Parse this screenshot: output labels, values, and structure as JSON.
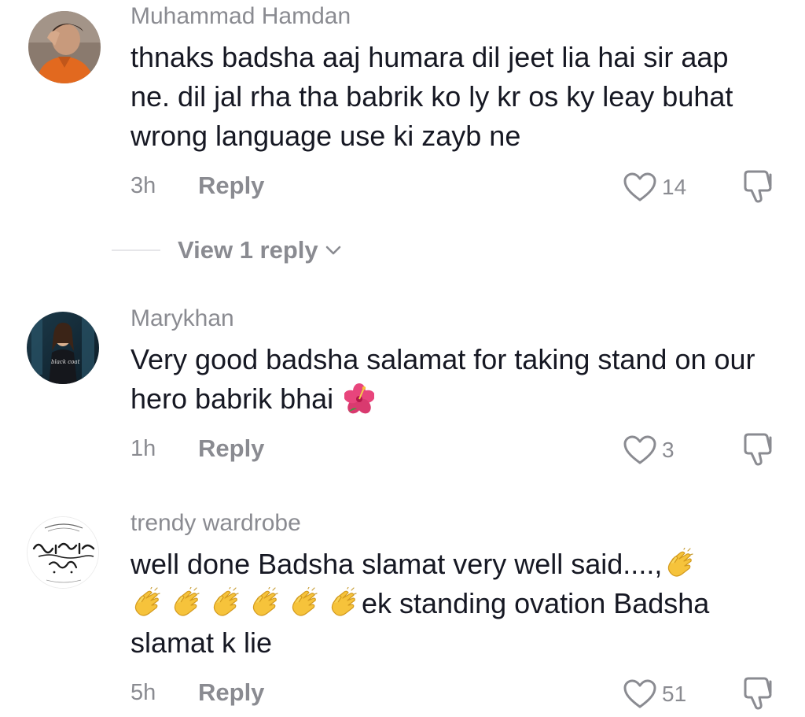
{
  "comments": [
    {
      "username": "Muhammad Hamdan",
      "text": "thnaks badsha aaj humara dil jeet lia hai sir aap ne. dil jal rha tha babrik ko ly kr os ky leay buhat wrong language use ki zayb ne",
      "time": "3h",
      "reply_label": "Reply",
      "likes": "14",
      "avatar_icon": "profile-photo-orange-shirt"
    },
    {
      "username": "Marykhan",
      "text": "Very good badsha salamat for taking stand on our hero babrik bhai",
      "trailing_emoji": "hibiscus-emoji",
      "time": "1h",
      "reply_label": "Reply",
      "likes": "3",
      "avatar_icon": "profile-photo-woman-dark",
      "avatar_text": "black coat"
    },
    {
      "username": "trendy wardrobe",
      "text_line1": "well done Badsha slamat very well said....,",
      "text_line2_suffix": "ek standing ovation Badsha",
      "text_line3": "slamat k lie",
      "clap_count": 7,
      "time": "5h",
      "reply_label": "Reply",
      "likes": "51",
      "avatar_icon": "urdu-calligraphy-avatar"
    }
  ],
  "view_replies_label": "View 1 reply",
  "colors": {
    "text": "#161823",
    "secondary": "#8a8b91",
    "divider": "#e6e6e9"
  }
}
